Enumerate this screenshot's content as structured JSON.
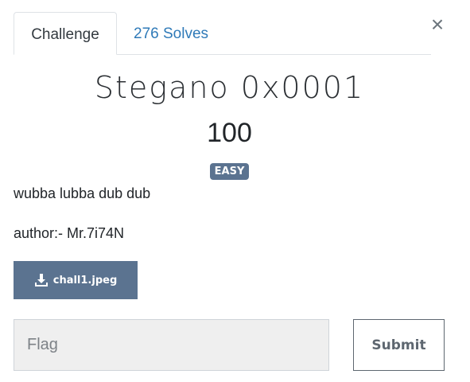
{
  "tabs": {
    "challenge_label": "Challenge",
    "solves_label": "276 Solves"
  },
  "close": {
    "symbol": "×"
  },
  "challenge": {
    "name": "Stegano 0x0001",
    "value": "100",
    "difficulty": "EASY",
    "description_line1": "wubba lubba dub dub",
    "description_line2": "author:- Mr.7i74N"
  },
  "file": {
    "name": "chall1.jpeg",
    "icon": "download-icon"
  },
  "flag_form": {
    "placeholder": "Flag",
    "value": "",
    "submit_label": "Submit"
  },
  "colors": {
    "accent": "#5b7390",
    "link": "#2f7ab8"
  }
}
